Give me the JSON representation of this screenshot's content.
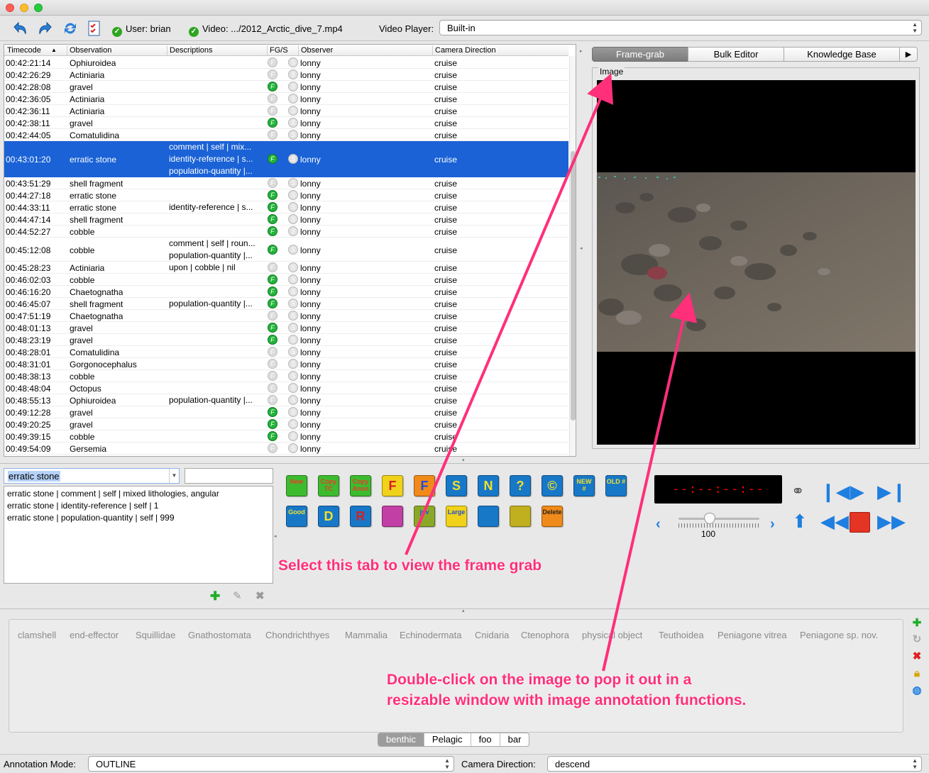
{
  "toolbar": {
    "user_label": "User: brian",
    "video_label": "Video: .../2012_Arctic_dive_7.mp4",
    "video_player_label": "Video Player:",
    "video_player_value": "Built-in"
  },
  "table": {
    "columns": [
      "Timecode",
      "Observation",
      "Descriptions",
      "FG/S",
      "Observer",
      "Camera Direction"
    ],
    "rows": [
      {
        "tc": "00:42:21:14",
        "obs": "Ophiuroidea",
        "desc": [],
        "fg": false,
        "observer": "lonny",
        "cam": "cruise"
      },
      {
        "tc": "00:42:26:29",
        "obs": "Actiniaria",
        "desc": [],
        "fg": false,
        "observer": "lonny",
        "cam": "cruise"
      },
      {
        "tc": "00:42:28:08",
        "obs": "gravel",
        "desc": [],
        "fg": true,
        "observer": "lonny",
        "cam": "cruise"
      },
      {
        "tc": "00:42:36:05",
        "obs": "Actiniaria",
        "desc": [],
        "fg": false,
        "observer": "lonny",
        "cam": "cruise"
      },
      {
        "tc": "00:42:36:11",
        "obs": "Actiniaria",
        "desc": [],
        "fg": false,
        "observer": "lonny",
        "cam": "cruise"
      },
      {
        "tc": "00:42:38:11",
        "obs": "gravel",
        "desc": [],
        "fg": true,
        "observer": "lonny",
        "cam": "cruise"
      },
      {
        "tc": "00:42:44:05",
        "obs": "Comatulidina",
        "desc": [],
        "fg": false,
        "observer": "lonny",
        "cam": "cruise"
      },
      {
        "tc": "00:43:01:20",
        "obs": "erratic stone",
        "desc": [
          "comment | self | mix...",
          "identity-reference | s...",
          "population-quantity |..."
        ],
        "fg": true,
        "observer": "lonny",
        "cam": "cruise",
        "selected": true
      },
      {
        "tc": "00:43:51:29",
        "obs": "shell fragment",
        "desc": [],
        "fg": false,
        "observer": "lonny",
        "cam": "cruise"
      },
      {
        "tc": "00:44:27:18",
        "obs": "erratic stone",
        "desc": [],
        "fg": true,
        "observer": "lonny",
        "cam": "cruise"
      },
      {
        "tc": "00:44:33:11",
        "obs": "erratic stone",
        "desc": [
          "identity-reference | s..."
        ],
        "fg": true,
        "observer": "lonny",
        "cam": "cruise"
      },
      {
        "tc": "00:44:47:14",
        "obs": "shell fragment",
        "desc": [],
        "fg": true,
        "observer": "lonny",
        "cam": "cruise"
      },
      {
        "tc": "00:44:52:27",
        "obs": "cobble",
        "desc": [],
        "fg": true,
        "observer": "lonny",
        "cam": "cruise"
      },
      {
        "tc": "00:45:12:08",
        "obs": "cobble",
        "desc": [
          "comment | self | roun...",
          "population-quantity |..."
        ],
        "fg": true,
        "observer": "lonny",
        "cam": "cruise"
      },
      {
        "tc": "00:45:28:23",
        "obs": "Actiniaria",
        "desc": [
          "upon | cobble | nil"
        ],
        "fg": false,
        "observer": "lonny",
        "cam": "cruise"
      },
      {
        "tc": "00:46:02:03",
        "obs": "cobble",
        "desc": [],
        "fg": true,
        "observer": "lonny",
        "cam": "cruise"
      },
      {
        "tc": "00:46:16:20",
        "obs": "Chaetognatha",
        "desc": [],
        "fg": true,
        "observer": "lonny",
        "cam": "cruise"
      },
      {
        "tc": "00:46:45:07",
        "obs": "shell fragment",
        "desc": [
          "population-quantity |..."
        ],
        "fg": true,
        "observer": "lonny",
        "cam": "cruise"
      },
      {
        "tc": "00:47:51:19",
        "obs": "Chaetognatha",
        "desc": [],
        "fg": false,
        "observer": "lonny",
        "cam": "cruise"
      },
      {
        "tc": "00:48:01:13",
        "obs": "gravel",
        "desc": [],
        "fg": true,
        "observer": "lonny",
        "cam": "cruise"
      },
      {
        "tc": "00:48:23:19",
        "obs": "gravel",
        "desc": [],
        "fg": true,
        "observer": "lonny",
        "cam": "cruise"
      },
      {
        "tc": "00:48:28:01",
        "obs": "Comatulidina",
        "desc": [],
        "fg": false,
        "observer": "lonny",
        "cam": "cruise"
      },
      {
        "tc": "00:48:31:01",
        "obs": "Gorgonocephalus",
        "desc": [],
        "fg": false,
        "observer": "lonny",
        "cam": "cruise"
      },
      {
        "tc": "00:48:38:13",
        "obs": "cobble",
        "desc": [],
        "fg": false,
        "observer": "lonny",
        "cam": "cruise"
      },
      {
        "tc": "00:48:48:04",
        "obs": "Octopus",
        "desc": [],
        "fg": false,
        "observer": "lonny",
        "cam": "cruise"
      },
      {
        "tc": "00:48:55:13",
        "obs": "Ophiuroidea",
        "desc": [
          "population-quantity |..."
        ],
        "fg": false,
        "observer": "lonny",
        "cam": "cruise"
      },
      {
        "tc": "00:49:12:28",
        "obs": "gravel",
        "desc": [],
        "fg": true,
        "observer": "lonny",
        "cam": "cruise"
      },
      {
        "tc": "00:49:20:25",
        "obs": "gravel",
        "desc": [],
        "fg": true,
        "observer": "lonny",
        "cam": "cruise"
      },
      {
        "tc": "00:49:39:15",
        "obs": "cobble",
        "desc": [],
        "fg": true,
        "observer": "lonny",
        "cam": "cruise"
      },
      {
        "tc": "00:49:54:09",
        "obs": "Gersemia",
        "desc": [],
        "fg": false,
        "observer": "lonny",
        "cam": "cruise"
      }
    ]
  },
  "tabs": [
    "Frame-grab",
    "Bulk Editor",
    "Knowledge Base"
  ],
  "image_panel_label": "Image",
  "editor": {
    "concept_value": "erratic stone",
    "descriptions": [
      "erratic stone | comment | self | mixed lithologies, angular",
      "erratic stone | identity-reference | self | 1",
      "erratic stone | population-quantity | self | 999"
    ]
  },
  "buttons": [
    {
      "label": "New",
      "bg": "#3dbb2f",
      "fg": "#e83b2a",
      "name": "new-button"
    },
    {
      "label": "Copy TC",
      "bg": "#3dbb2f",
      "fg": "#e83b2a",
      "name": "copy-tc-button"
    },
    {
      "label": "Copy Anno",
      "bg": "#3dbb2f",
      "fg": "#e83b2a",
      "name": "copy-anno-button"
    },
    {
      "label": "F",
      "bg": "#f0d21a",
      "fg": "#d81f1f",
      "name": "f-button"
    },
    {
      "label": "F",
      "bg": "#f08a1a",
      "fg": "#1f4fd8",
      "name": "f-remove-button"
    },
    {
      "label": "S",
      "bg": "#1878c8",
      "fg": "#f2e02a",
      "name": "s-button"
    },
    {
      "label": "N",
      "bg": "#1878c8",
      "fg": "#f2e02a",
      "name": "n-button"
    },
    {
      "label": "?",
      "bg": "#1878c8",
      "fg": "#f2e02a",
      "name": "question-button"
    },
    {
      "label": "©",
      "bg": "#1878c8",
      "fg": "#f2e02a",
      "name": "copyright-button"
    },
    {
      "label": "NEW #",
      "bg": "#1878c8",
      "fg": "#f2e02a",
      "name": "new-number-button"
    },
    {
      "label": "OLD #",
      "bg": "#1878c8",
      "fg": "#f2e02a",
      "name": "old-number-button"
    },
    {
      "label": "Good",
      "bg": "#1878c8",
      "fg": "#f2e02a",
      "name": "good-button"
    },
    {
      "label": "D",
      "bg": "#1878c8",
      "fg": "#f2e02a",
      "name": "d-button"
    },
    {
      "label": "R",
      "bg": "#1878c8",
      "fg": "#d81f1f",
      "name": "r-button"
    },
    {
      "label": "",
      "bg": "#c23fa6",
      "fg": "#ffffff",
      "name": "link-button"
    },
    {
      "label": "juv",
      "bg": "#8aa828",
      "fg": "#1f4fd8",
      "name": "juv-button"
    },
    {
      "label": "Large",
      "bg": "#f0d21a",
      "fg": "#1f4fd8",
      "name": "large-button"
    },
    {
      "label": "",
      "bg": "#1878c8",
      "fg": "#f2e02a",
      "name": "underline-button"
    },
    {
      "label": "",
      "bg": "#c0b020",
      "fg": "#ffffff",
      "name": "comment-button"
    },
    {
      "label": "Delete",
      "bg": "#f08a1a",
      "fg": "#1f1f1f",
      "name": "delete-button"
    }
  ],
  "video": {
    "timecode": "--:--:--:--",
    "speed": "100"
  },
  "knowledge_base": {
    "items": [
      "clamshell",
      "end-effector",
      "Squillidae",
      "Gnathostomata",
      "Chondrichthyes",
      "Mammalia",
      "Echinodermata",
      "Cnidaria",
      "Ctenophora",
      "physical object",
      "Teuthoidea",
      "Peniagone vitrea",
      "Peniagone sp. nov."
    ],
    "groups": [
      "benthic",
      "Pelagic",
      "foo",
      "bar"
    ]
  },
  "status": {
    "annotation_mode_label": "Annotation Mode:",
    "annotation_mode_value": "OUTLINE",
    "camera_direction_label": "Camera Direction:",
    "camera_direction_value": "descend"
  },
  "callouts": {
    "tab_hint": "Select this tab to view the frame grab",
    "image_hint_1": "Double-click on the image to pop it out in a",
    "image_hint_2": "resizable window with image annotation functions."
  },
  "colors": {
    "selection": "#1a62d6",
    "annotation": "#ff2f7a",
    "accent": "#1f7fe0"
  }
}
